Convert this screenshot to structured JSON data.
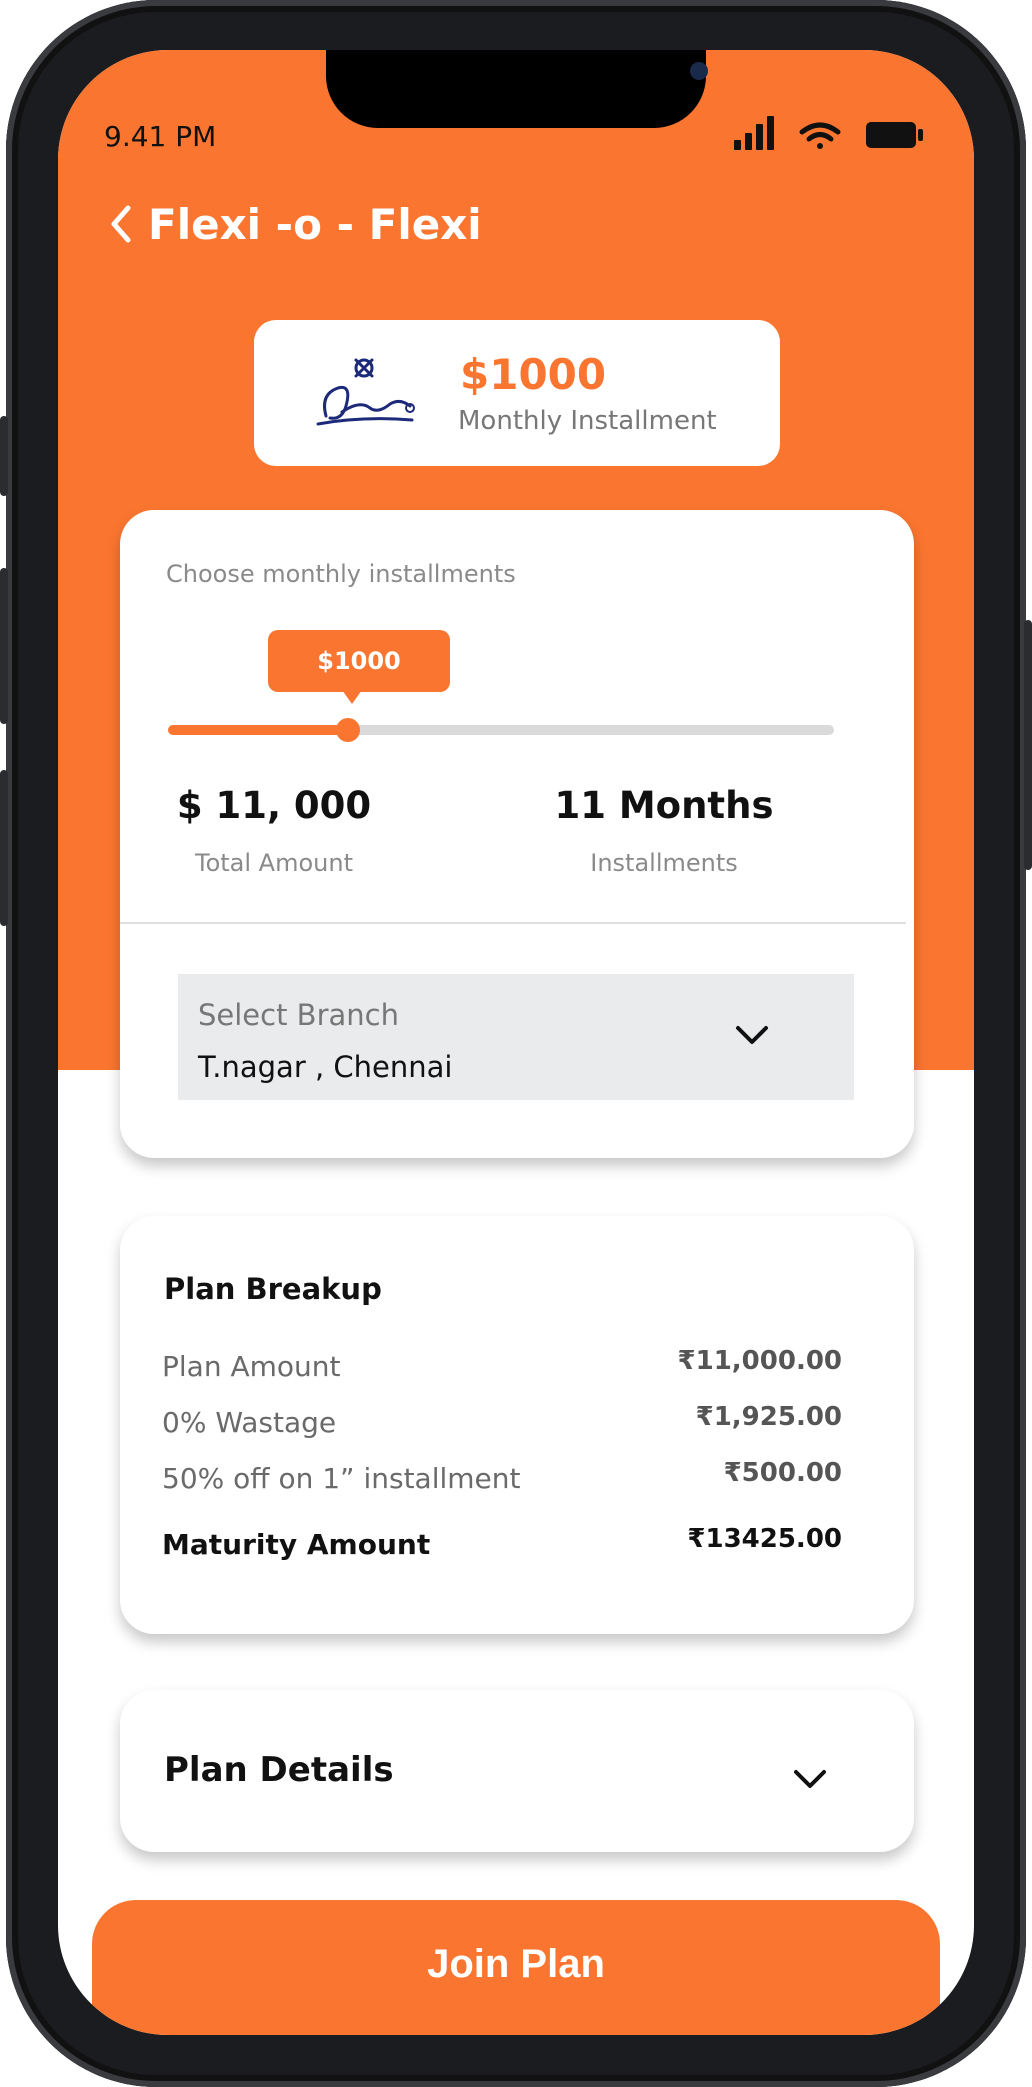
{
  "status_bar": {
    "time": "9.41 PM",
    "icons": [
      "signal-icon",
      "wifi-icon",
      "battery-icon"
    ]
  },
  "header": {
    "title": "Flexi -o - Flexi",
    "back_icon": "chevron-left-icon"
  },
  "summary": {
    "logo_name": "lalithaa-logo",
    "amount": "$1000",
    "label": "Monthly Installment"
  },
  "installment_selector": {
    "label": "Choose monthly installments",
    "tooltip": "$1000",
    "slider_fraction": 0.27,
    "total_amount": "$ 11, 000",
    "total_amount_label": "Total Amount",
    "installments": "11 Months",
    "installments_label": "Installments"
  },
  "branch": {
    "label": "Select Branch",
    "value": "T.nagar , Chennai",
    "icon": "chevron-down-icon"
  },
  "plan_breakup": {
    "title": "Plan Breakup",
    "rows": [
      {
        "label": "Plan Amount",
        "value": "₹11,000.00"
      },
      {
        "label": "0% Wastage",
        "value": "₹1,925.00"
      },
      {
        "label": "50% off on 1” installment",
        "value": "₹500.00"
      }
    ],
    "total": {
      "label": "Maturity Amount",
      "value": "₹13425.00"
    }
  },
  "plan_details": {
    "title": "Plan Details",
    "icon": "chevron-down-icon"
  },
  "action": {
    "join_label": "Join Plan"
  },
  "colors": {
    "accent": "#fa7630",
    "select_bg": "#e9ebec",
    "logo_blue": "#1d2a7a"
  }
}
